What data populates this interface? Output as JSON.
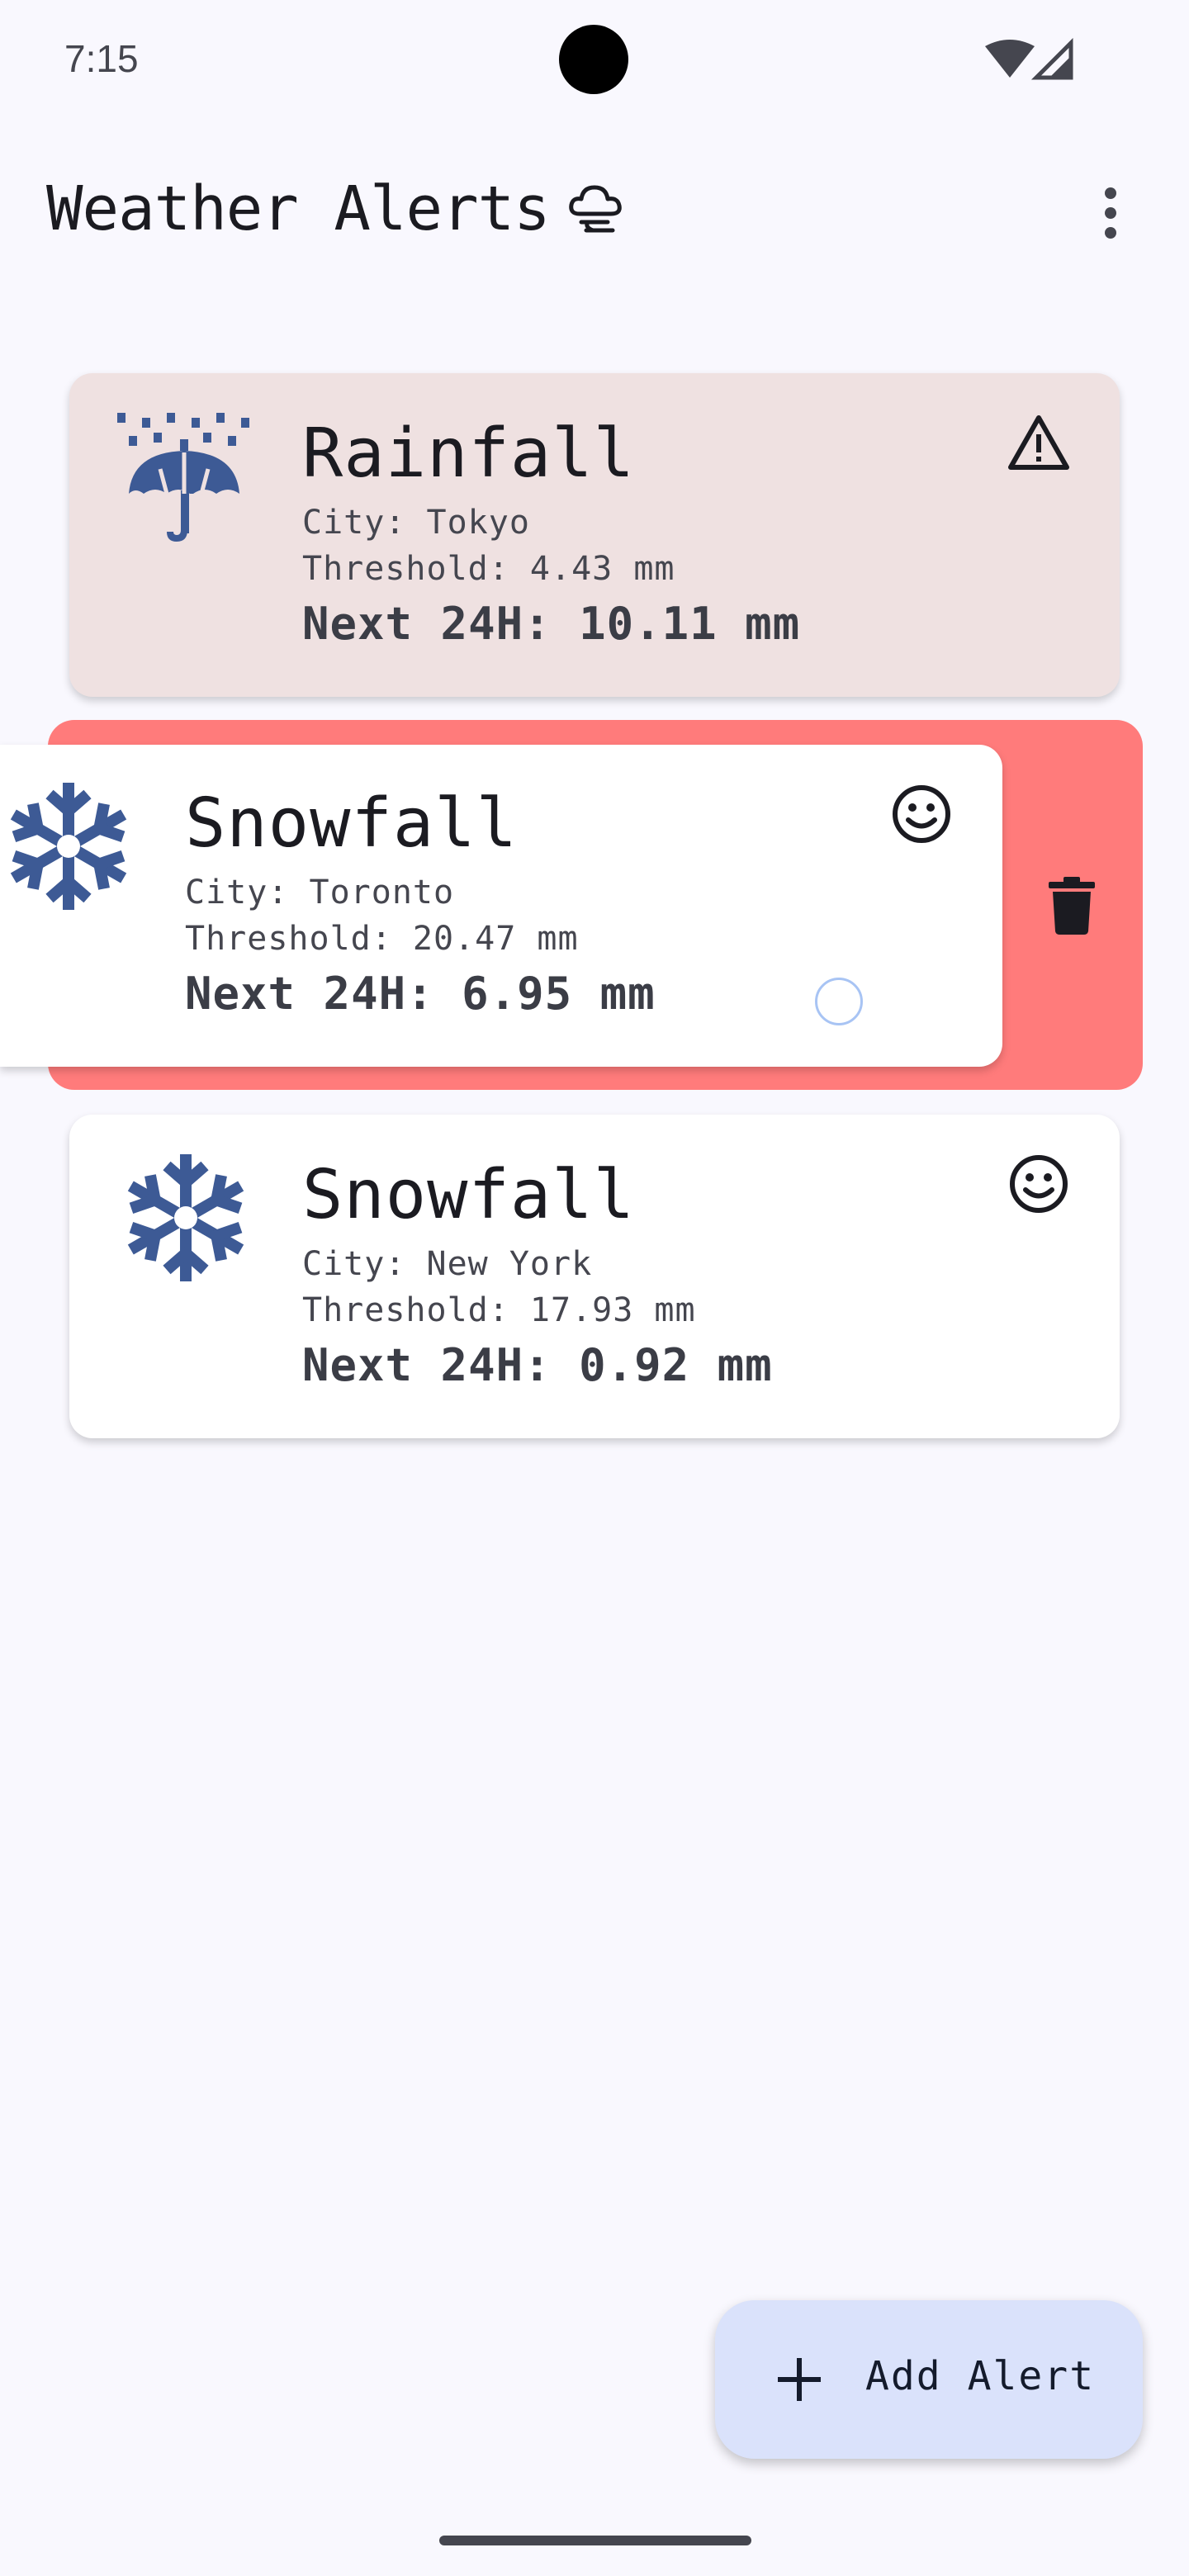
{
  "status_bar": {
    "time": "7:15"
  },
  "app_bar": {
    "title": "Weather Alerts",
    "title_icon": "storm-cloud-icon",
    "menu_icon": "more-vert-icon"
  },
  "alerts": [
    {
      "type": "Rainfall",
      "city": "City: Tokyo",
      "threshold": "Threshold: 4.43 mm",
      "forecast": "Next 24H: 10.11 mm",
      "icon": "umbrella-rain-icon",
      "status_icon": "warning-icon",
      "background": "#efe1e1"
    },
    {
      "type": "Snowfall",
      "city": "City: Toronto",
      "threshold": "Threshold: 20.47 mm",
      "forecast": "Next 24H: 6.95 mm",
      "icon": "snowflake-icon",
      "status_icon": "smiley-icon",
      "background": "#ffffff"
    },
    {
      "type": "Snowfall",
      "city": "City: New York",
      "threshold": "Threshold: 17.93 mm",
      "forecast": "Next 24H: 0.92 mm",
      "icon": "snowflake-icon",
      "status_icon": "smiley-icon",
      "background": "#ffffff"
    }
  ],
  "swipe_action": {
    "icon": "delete-icon",
    "background": "#ff7b7b"
  },
  "fab": {
    "label": "Add Alert",
    "icon": "add-icon",
    "background": "#dae2fb"
  },
  "colors": {
    "accent_icon": "#3d5a95",
    "screen_background": "#f9f8fe"
  }
}
